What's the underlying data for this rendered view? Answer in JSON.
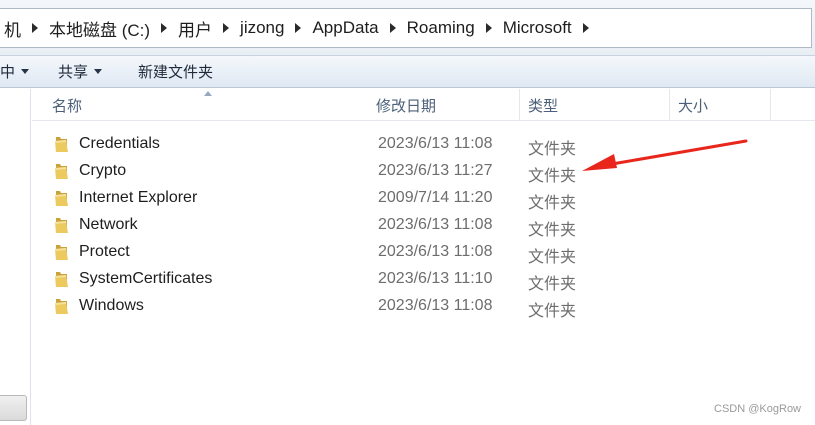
{
  "address": {
    "crumbs": [
      "机",
      "本地磁盘 (C:)",
      "用户",
      "jizong",
      "AppData",
      "Roaming",
      "Microsoft"
    ]
  },
  "toolbar": {
    "left_label": "中",
    "share_label": "共享",
    "new_folder_label": "新建文件夹"
  },
  "columns": {
    "name": "名称",
    "modified": "修改日期",
    "type": "类型",
    "size": "大小"
  },
  "files": [
    {
      "name": "Credentials",
      "modified": "2023/6/13 11:08",
      "type": "文件夹",
      "icon": "folder-icon"
    },
    {
      "name": "Crypto",
      "modified": "2023/6/13 11:27",
      "type": "文件夹",
      "icon": "folder-icon"
    },
    {
      "name": "Internet Explorer",
      "modified": "2009/7/14 11:20",
      "type": "文件夹",
      "icon": "folder-icon"
    },
    {
      "name": "Network",
      "modified": "2023/6/13 11:08",
      "type": "文件夹",
      "icon": "folder-icon"
    },
    {
      "name": "Protect",
      "modified": "2023/6/13 11:08",
      "type": "文件夹",
      "icon": "folder-icon"
    },
    {
      "name": "SystemCertificates",
      "modified": "2023/6/13 11:10",
      "type": "文件夹",
      "icon": "folder-icon"
    },
    {
      "name": "Windows",
      "modified": "2023/6/13 11:08",
      "type": "文件夹",
      "icon": "folder-icon"
    }
  ],
  "annotation": {
    "icon": "red-arrow-icon",
    "color": "#e8261c",
    "points_to": "Crypto"
  },
  "colors": {
    "folder": "#e9c75a",
    "folder_dark": "#c9a23a",
    "toolbar_text": "#1e2a3a",
    "header_text": "#4c607a"
  },
  "watermark": "CSDN @KogRow"
}
